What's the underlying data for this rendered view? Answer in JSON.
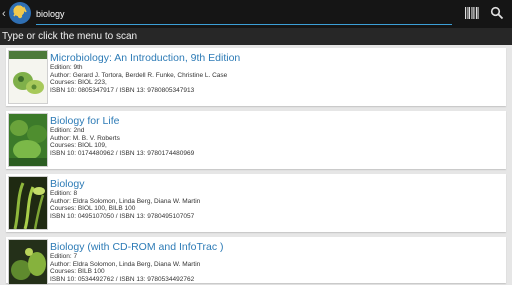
{
  "header": {
    "search_value": "biology",
    "logo_icon": "scanner-app-logo",
    "back_icon": "back-chevron-icon",
    "barcode_icon": "barcode-icon",
    "search_icon": "search-icon"
  },
  "instruction": "Type or click the  menu to scan",
  "books": [
    {
      "title": "Microbiology: An Introduction, 9th Edition",
      "edition": "Edition: 9th",
      "author": "Author:  Gerard J. Tortora, Berdell R. Funke, Christine L. Case",
      "courses": "Courses: BIOL 223,",
      "isbn": "ISBN 10: 0805347917 / ISBN 13: 9780805347913",
      "cover_word": "MICROBIOLOGY"
    },
    {
      "title": "Biology for Life",
      "edition": "Edition: 2nd",
      "author": "Author:  M. B. V. Roberts",
      "courses": "Courses: BIOL 109,",
      "isbn": "ISBN 10: 0174480962 / ISBN 13: 9780174480969",
      "cover_word": "BIOLOGY"
    },
    {
      "title": "Biology",
      "edition": "Edition: 8",
      "author": "Author:  Eldra Solomon, Linda Berg, Diana W. Martin",
      "courses": "Courses: BIOL 100, BILB 100",
      "isbn": "ISBN 10: 0495107050 / ISBN 13: 9780495107057",
      "cover_word": "Biology"
    },
    {
      "title": "Biology (with CD-ROM and InfoTrac )",
      "edition": "Edition: 7",
      "author": "Author:  Eldra Solomon, Linda Berg, Diana W. Martin",
      "courses": "Courses: BILB 100",
      "isbn": "ISBN 10: 0534492762 / ISBN 13: 9780534492762",
      "cover_word": "Biology"
    }
  ]
}
